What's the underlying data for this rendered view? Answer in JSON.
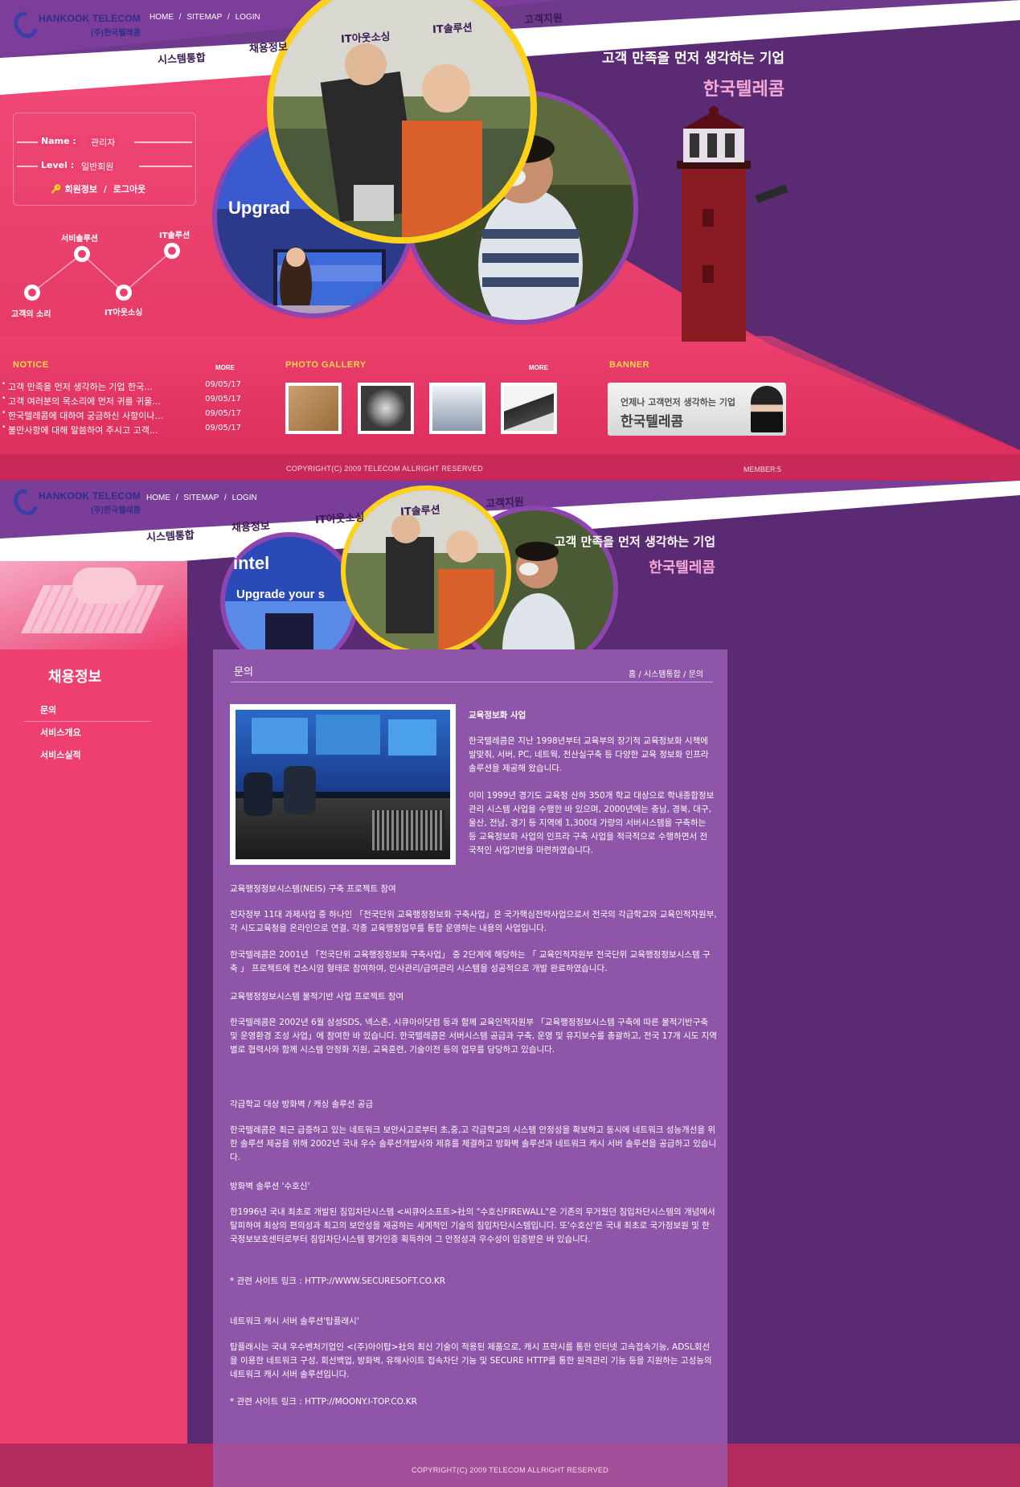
{
  "brand": {
    "logo_en": "HANKOOK TELECOM",
    "logo_ko": "(주)한국텔레콤"
  },
  "top_links": [
    "HOME",
    "/",
    "SITEMAP",
    "/",
    "LOGIN"
  ],
  "main_menu": {
    "item1": "시스템통합",
    "item2": "채용정보",
    "item3": "IT아웃소싱",
    "item4": "IT솔루션",
    "item5": "고객지원"
  },
  "slogan": {
    "line1": "고객 만족을 먼저 생각하는 기업",
    "line2": "한국텔레콤"
  },
  "hero": {
    "upgrade_text": "Upgrad"
  },
  "login": {
    "name_label": "Name :",
    "name_value": "관리자",
    "level_label": "Level :",
    "level_value": "일반회원",
    "member_info": "회원정보",
    "separator": "/",
    "logout": "로그아웃"
  },
  "network": {
    "node1": "고객의 소리",
    "node2": "서비솔루션",
    "node3": "IT아웃소싱",
    "node4": "IT솔루션"
  },
  "notice": {
    "title": "NOTICE",
    "more": "MORE",
    "items": [
      {
        "text": "고객 만족을 먼저 생각하는 기업 한국...",
        "date": "09/05/17"
      },
      {
        "text": "고객 여러분의 목소리에 먼저 귀를 귀울...",
        "date": "09/05/17"
      },
      {
        "text": "한국텔레콤에 대하여 궁금하신 사항이나...",
        "date": "09/05/17"
      },
      {
        "text": "불만사항에 대해 말씀하여 주시고 고객...",
        "date": "09/05/17"
      }
    ]
  },
  "gallery": {
    "title": "PHOTO GALLERY",
    "more": "MORE"
  },
  "banner": {
    "title": "BANNER",
    "line1": "언제나 고객먼저 생각하는 기업",
    "line2": "한국텔레콤"
  },
  "footer": {
    "copyright": "COPYRIGHT(C) 2009 TELECOM ALLRIGHT RESERVED",
    "member": "MEMBER:5"
  },
  "sub_hero": {
    "intel_text": "intel",
    "upgrade_text": "Upgrade your s",
    "upgrade_text2": "Upgrad"
  },
  "sidebar": {
    "title": "채용정보",
    "items": [
      "문의",
      "서비스개요",
      "서비스실적"
    ]
  },
  "content": {
    "page_title": "문의",
    "breadcrumb": "홈 / 시스템통합 / 문의",
    "section_title": "교육정보화 사업",
    "intro_p1": "한국텔레콤은 지난 1998년부터 교육부의 장기적 교육정보화 시책에 발맞춰, 서버, PC, 네트웍, 전산실구축 등 다양한 교육 정보화 인프라 솔루션을 제공해 왔습니다.",
    "intro_p2": "이미 1999년 경기도 교육청 산하 350개 학교 대상으로 학내종합정보관리 시스템 사업을 수행한 바 있으며, 2000년에는 충남, 경북, 대구, 울산, 전남, 경기 등 지역에 1,300대 가량의 서버시스템을 구축하는 등 교육정보화 사업의 인프라 구축 사업을 적극적으로 수행하면서 전국적인 사업기반을 마련하였습니다.",
    "h1": "교육행정정보시스템(NEIS) 구축 프로젝트 참여",
    "p1": "전자정부 11대 과제사업 중 하나인 「전국단위 교육행정정보화 구축사업」은 국가핵심전략사업으로서 전국의 각급학교와 교육인적자원부, 각 시도교육청을 온라인으로 연결, 각종 교육행정업무를 통합 운영하는 내용의 사업입니다.",
    "p2": "한국텔레콤은 2001년 「전국단위 교육행정정보화 구축사업」 중 2단계에 해당하는 「 교육인적자원부 전국단위 교육행정정보시스템 구축 」 프로젝트에 컨소시엄 형태로 참여하여, 인사관리/급여관리 시스템을 성공적으로 개발 완료하였습니다.",
    "h2": "교육행정정보시스템 물적기반 사업 프로젝트 참여",
    "p3": "한국텔레콤은 2002년 6월 삼성SDS, 넥스존, 시큐아이닷컴 등과 함께 교육인적자원부 「교육행정정보시스템 구축에 따른 물적기반구축 및 운영환경 조성 사업」에 참여한 바 있습니다. 한국텔레콤은 서버시스템 공급과 구축, 운영 및 유지보수를 총괄하고, 전국 17개 시도 지역별로 협력사와 함께 시스템 안정화 지원, 교육훈련, 기술이전 등의 업무를 담당하고 있습니다.",
    "h3": "각급학교 대상 방화벽 / 캐싱 솔루션 공급",
    "p4": "한국텔레콤은 최근 급증하고 있는 네트워크 보안사고로부터 초,중,고 각급학교의 시스템 안정성을 확보하고 동시에 네트워크 성능개선을 위한 솔루션 제공을 위해 2002년 국내 우수 솔루션개발사와 제휴를 체결하고 방화벽 솔루션과 네트워크 캐시 서버 솔루션을 공급하고 있습니다.",
    "h4": "방화벽 솔루션 '수호신'",
    "p5": "한1996년 국내 최초로 개발된 침입차단시스템 <씨큐어소프트>社의 \"수호신FIREWALL\"은 기존의 무거웠던 침입차단시스템의 개념에서 탈피하여 최상의 편의성과 최고의 보안성을 제공하는 세계적인 기술의 침입차단시스템입니다. 또'수호신'은 국내 최초로 국가정보원 및 한국정보보호센터로부터 침입차단시스템 평가인증 획득하여 그 안정성과 우수성이 입증받은 바 있습니다.",
    "link1": "* 관련 사이트 링크 : HTTP://WWW.SECURESOFT.CO.KR",
    "h5": "네트워크 캐시 서버 솔루션'탑플래시'",
    "p6": "탑플래시는 국내 우수벤처기업인 <(주)아이탑>社의 최신 기술이 적용된 제품으로, 캐시 프락시를 통한 인터넷 고속접속기능, ADSL회선을 이용한 네트워크 구성, 회선백업, 방화벽, 유해사이트 접속차단 기능 및 SECURE HTTP를 통한 원격관리 기능 등을 지원하는 고성능의 네트워크 캐시 서버 솔루션입니다.",
    "link2": "* 관련 사이트 링크 : HTTP://MOONY.I-TOP.CO.KR"
  },
  "colors": {
    "pink": "#ee3f70",
    "purple": "#5a2a72",
    "content_purple": "#8e55a8",
    "yellow": "#ffd84a"
  }
}
